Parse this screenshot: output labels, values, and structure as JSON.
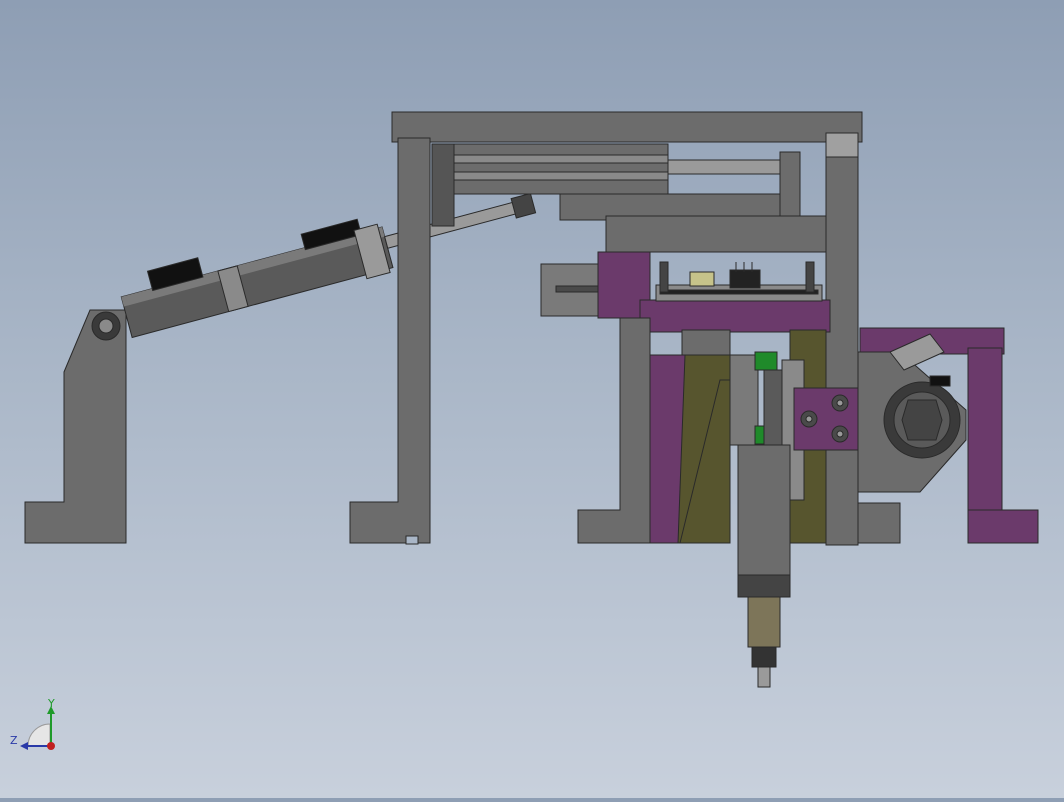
{
  "viewport": {
    "background_top": "#8e9eb4",
    "background_bottom": "#c8d0dc"
  },
  "colors": {
    "frame_gray": "#6c6c6c",
    "frame_edge": "#2a2a2a",
    "dark_gray": "#4a4a4a",
    "purple": "#6b3a6b",
    "olive": "#57552e",
    "green": "#1f8a2a",
    "black": "#111111",
    "light_gray": "#9a9a9a",
    "bronze": "#7d7559"
  },
  "triad": {
    "y_label": "Y",
    "z_label": "Z",
    "icon": "coordinate-triad-icon"
  }
}
